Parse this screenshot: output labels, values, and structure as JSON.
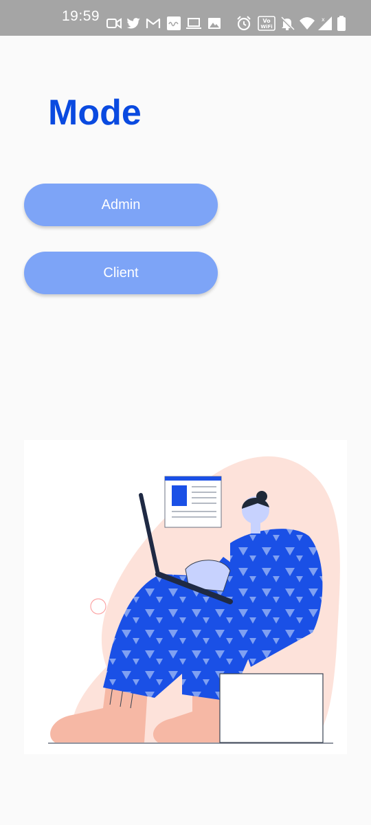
{
  "status_bar": {
    "time": "19:59",
    "icons": [
      "video-call-icon",
      "twitter-icon",
      "gmail-icon",
      "ultima-app-icon",
      "laptop-icon",
      "image-icon",
      "alarm-icon",
      "vowifi-icon",
      "mute-notifications-icon",
      "wifi-icon",
      "cellular-signal-icon",
      "battery-icon"
    ]
  },
  "header": {
    "title": "Mode"
  },
  "buttons": {
    "admin_label": "Admin",
    "client_label": "Client"
  },
  "colors": {
    "title": "#0a4ae0",
    "button_bg": "#7da4f7",
    "button_text": "#ffffff",
    "status_bar_bg": "#a5a5a5",
    "illustration_blue": "#1a50e6",
    "illustration_peach": "#f6b8a5"
  },
  "illustration": {
    "icon": "person-with-laptop-illustration"
  }
}
